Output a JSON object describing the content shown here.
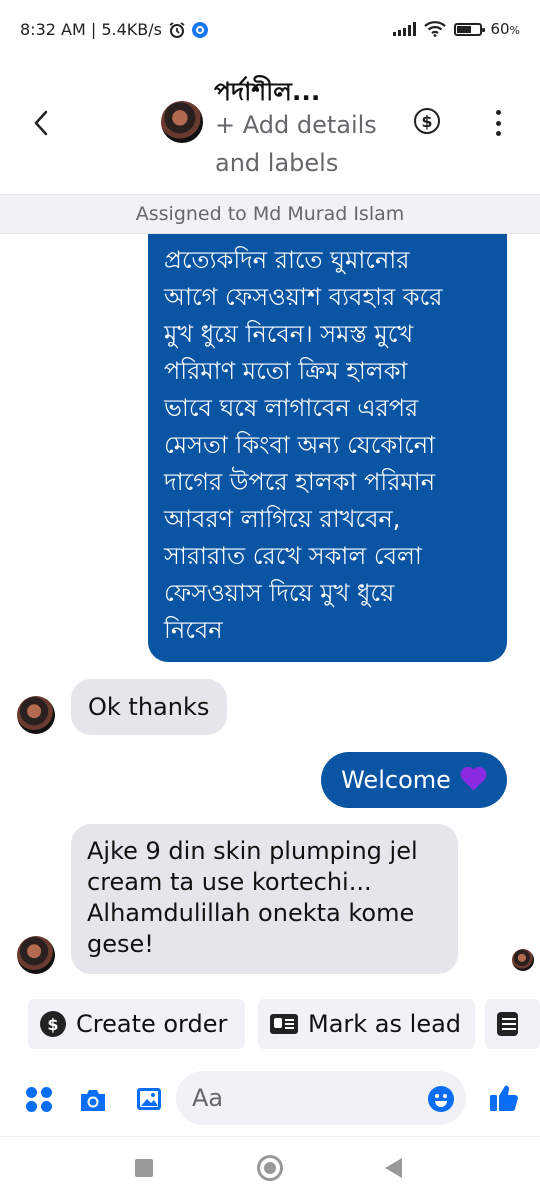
{
  "status_bar": {
    "time_speed": "8:32 AM | 5.4KB/s",
    "battery": "60",
    "battery_unit": "%",
    "icons": [
      "alarm-icon",
      "messenger-notification-icon",
      "signal-icon",
      "wifi-icon",
      "battery-icon"
    ]
  },
  "header": {
    "title": "পর্দাশীল...",
    "add_details": "+ Add details and labels",
    "dollar_symbol": "$",
    "icons": [
      "back-arrow-icon",
      "dollar-icon",
      "more-vertical-icon"
    ]
  },
  "assigned": "Assigned to Md Murad Islam",
  "messages": [
    {
      "direction": "outgoing",
      "text": "প্রত্যেকদিন রাতে ঘুমানোর\nআগে ফেসওয়াশ ব্যবহার করে\nমুখ ধুয়ে নিবেন। সমস্ত মুখে\nপরিমাণ মতো  ক্রিম হালকা\nভাবে ঘষে লাগাবেন এরপর\nমেসতা কিংবা অন্য যেকোনো\nদাগের উপরে হালকা পরিমান\nআবরণ লাগিয়ে রাখবেন,\nসারারাত রেখে সকাল বেলা\nফেসওয়াস দিয়ে মুখ ধুয়ে\nনিবেন"
    },
    {
      "direction": "incoming",
      "text": "Ok thanks"
    },
    {
      "direction": "outgoing",
      "text": "Welcome",
      "emoji": "purple-heart"
    },
    {
      "direction": "incoming",
      "text": "Ajke 9 din skin plumping jel cream ta use kortechi... Alhamdulillah onekta kome gese!"
    }
  ],
  "quick_actions": [
    {
      "label": "Create order",
      "icon": "dollar-circle-icon"
    },
    {
      "label": "Mark as lead",
      "icon": "contact-card-icon"
    },
    {
      "label": "",
      "icon": "form-icon"
    }
  ],
  "composer": {
    "placeholder": "Aa",
    "icons": [
      "apps-icon",
      "camera-icon",
      "gallery-icon",
      "emoji-icon",
      "thumbs-up-icon"
    ]
  },
  "colors": {
    "outgoing_bubble": "#0a54a4",
    "incoming_bubble": "#e4e6eb",
    "accent": "#0a6ef5",
    "heart": "#8a2be2"
  }
}
